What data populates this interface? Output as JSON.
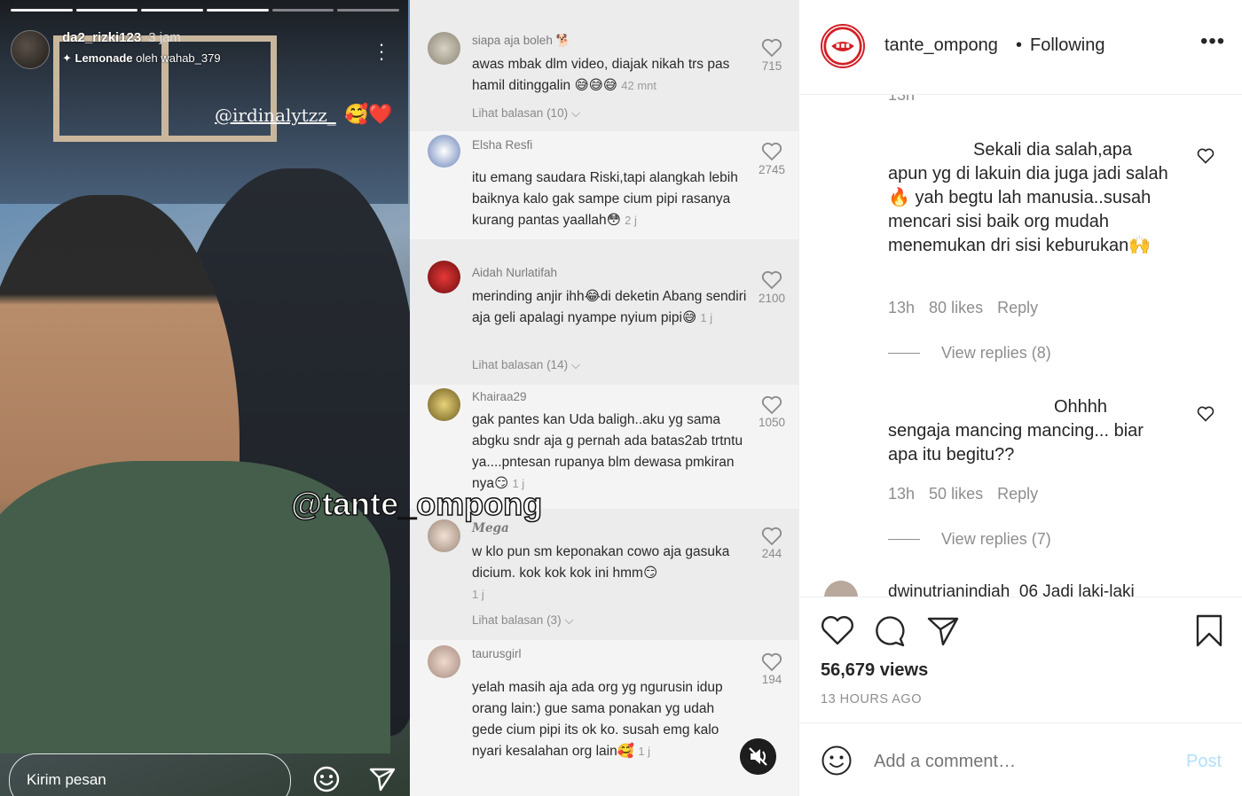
{
  "story": {
    "username": "da2_rizki123",
    "time": "3 jam",
    "music_song": "Lemonade",
    "music_by": "oleh wahab_379",
    "tag": "@irdinalytzz_",
    "tag_emoji": "🥰❤️",
    "watermark": "@tante_ompong",
    "message_placeholder": "Kirim pesan",
    "icons": [
      "more-vertical-icon",
      "emoji-icon",
      "send-icon",
      "sparkle-music-icon"
    ]
  },
  "tiktok": {
    "comments": [
      {
        "user": "siapa aja boleh 🐕",
        "text": "awas mbak dlm video, diajak nikah trs pas hamil ditinggalin 😅😅😅",
        "time": "42 mnt",
        "likes": "715",
        "replies": "Lihat balasan (10)"
      },
      {
        "user": "Elsha Resfi",
        "text": "itu emang saudara Riski,tapi alangkah lebih baiknya kalo gak sampe cium pipi rasanya kurang pantas yaallah😳",
        "time": "2 j",
        "likes": "2745",
        "replies": ""
      },
      {
        "user": "Aidah Nurlatifah",
        "text": "merinding anjir ihh😂di deketin Abang sendiri aja geli apalagi nyampe nyium pipi😅",
        "time": "1 j",
        "likes": "2100",
        "replies": "Lihat balasan (14)"
      },
      {
        "user": "Khairaa29",
        "text": "gak pantes kan Uda baligh..aku yg sama abgku sndr aja g pernah ada batas2ab trtntu ya....pntesan rupanya blm dewasa pmkiran nya😏",
        "time": "1 j",
        "likes": "1050",
        "replies": ""
      },
      {
        "user": "Mega",
        "text": "w klo pun sm keponakan cowo aja gasuka dicium. kok kok kok ini hmm😏",
        "time": "1 j",
        "likes": "244",
        "replies": "Lihat balasan (3)"
      },
      {
        "user": "taurusgirl",
        "text": "yelah masih aja ada org yg ngurusin idup orang lain:) gue sama ponakan yg udah gede cium pipi its ok ko. susah emg kalo nyari kesalahan org lain🥰",
        "time": "1 j",
        "likes": "194",
        "replies": ""
      }
    ]
  },
  "instagram": {
    "username": "tante_ompong",
    "dot": "•",
    "following": "Following",
    "top_partial_time": "13h",
    "comments": [
      {
        "text": "Sekali dia salah,apa apun yg di lakuin dia juga jadi salah🔥 yah begtu lah manusia..susah mencari sisi baik org mudah menemukan dri sisi keburukan🙌",
        "time": "13h",
        "likes": "80 likes",
        "reply": "Reply",
        "view_replies": "View replies (8)"
      },
      {
        "text": "Ohhhh sengaja mancing mancing... biar apa itu begitu??",
        "time": "13h",
        "likes": "50 likes",
        "reply": "Reply",
        "view_replies": "View replies (7)"
      }
    ],
    "partial_comment": "dwinutrianindiah_06 Jadi laki-laki",
    "views": "56,679 views",
    "time_ago": "13 HOURS AGO",
    "add_comment_placeholder": "Add a comment…",
    "post_label": "Post",
    "icons": [
      "heart-icon",
      "comment-icon",
      "share-icon",
      "bookmark-icon",
      "emoji-icon",
      "more-horizontal-icon"
    ]
  }
}
